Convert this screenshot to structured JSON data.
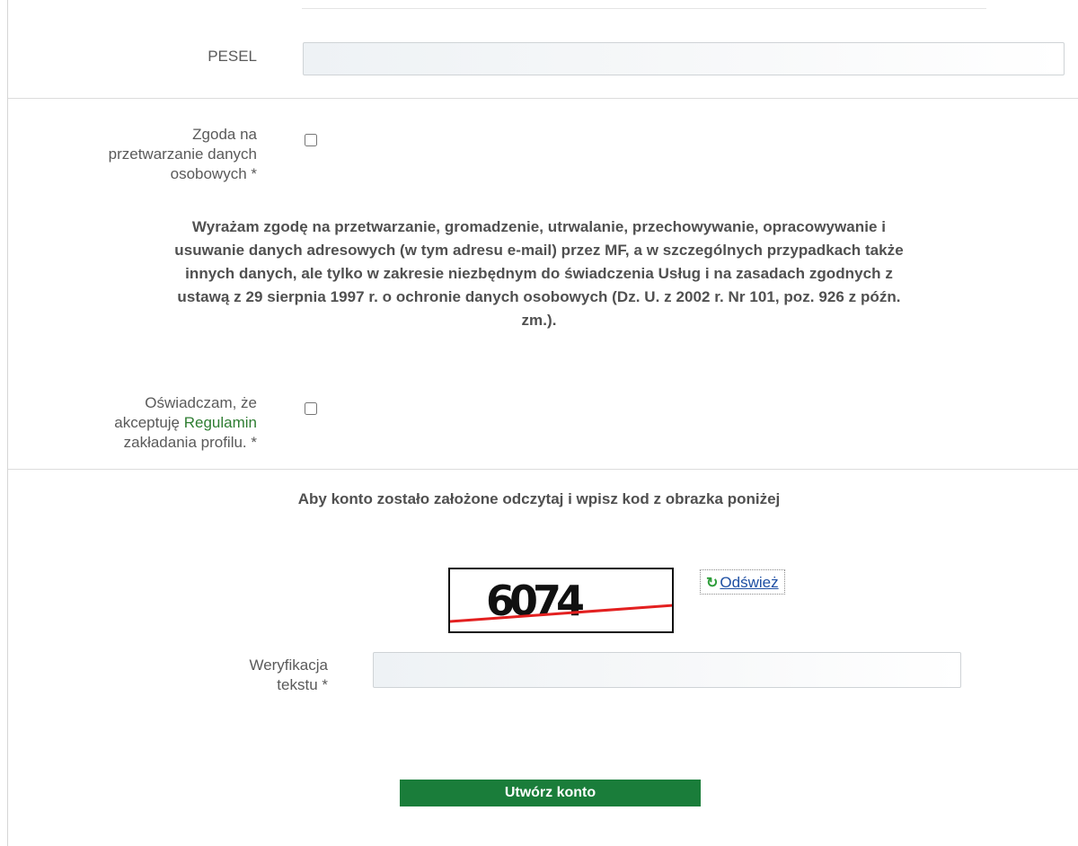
{
  "form": {
    "pesel": {
      "label": "PESEL",
      "value": ""
    },
    "consent_data": {
      "label_line1": "Zgoda na",
      "label_line2": "przetwarzanie danych",
      "label_line3": "osobowych *",
      "checked": false
    },
    "consent_text_lines": [
      "Wyrażam zgodę na przetwarzanie, gromadzenie, utrwalanie, przechowywanie, opracowywanie i",
      "usuwanie danych adresowych (w tym adresu e-mail) przez MF, a w szczególnych przypadkach także",
      "innych danych, ale tylko w zakresie niezbędnym do świadczenia Usług i na zasadach zgodnych z",
      "ustawą z 29 sierpnia 1997 r. o ochronie danych osobowych (Dz. U. z 2002 r. Nr 101, poz. 926 z późn.",
      "zm.)."
    ],
    "regulations": {
      "label_line1": "Oświadczam, że",
      "label_line2_prefix": "akceptuję ",
      "label_link": "Regulamin",
      "label_line3": "zakładania profilu. *",
      "checked": false
    },
    "captcha": {
      "heading": "Aby konto zostało założone odczytaj i wpisz kod z obrazka poniżej",
      "code": "6074",
      "refresh_icon": "refresh-icon",
      "refresh_label": "Odśwież"
    },
    "verification": {
      "label_line1": "Weryfikacja",
      "label_line2": "tekstu *",
      "value": ""
    },
    "submit_label": "Utwórz konto"
  },
  "colors": {
    "accent_green": "#1a7d3a",
    "link_green": "#2e7d32",
    "link_blue": "#1e4fa3",
    "captcha_line": "#e32020"
  }
}
